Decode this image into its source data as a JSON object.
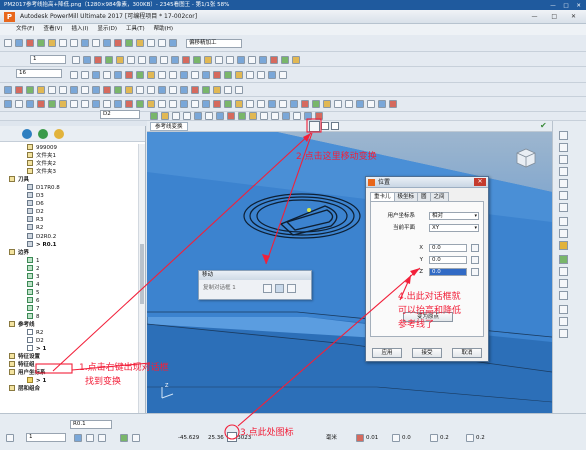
{
  "viewer": {
    "title": "PM2017参考线抬高+降低.png（1280×984像素，300KB）- 2345看图王 - 第1/1张 58%",
    "window_controls": "— □ ✕"
  },
  "app": {
    "logo": "P",
    "title": "Autodesk PowerMill Ultimate 2017   [可编程项目 * 17-002cor]"
  },
  "menu": [
    "文件(F)",
    "查看(V)",
    "插入(I)",
    "显示(D)",
    "工具(T)",
    "帮助(H)"
  ],
  "toolbar": {
    "combo_level": "1",
    "combo_num": "16",
    "toolpath_label": "偏移精加工",
    "combo_d2": "D2"
  },
  "left_panel": {
    "tree": [
      {
        "label": "999009",
        "kind": "folder",
        "indent": 3
      },
      {
        "label": "文件夹1",
        "kind": "folder",
        "indent": 3
      },
      {
        "label": "文件夹2",
        "kind": "folder",
        "indent": 3
      },
      {
        "label": "文件夹3",
        "kind": "folder",
        "indent": 3
      },
      {
        "label": "刀具",
        "kind": "group",
        "indent": 1
      },
      {
        "label": "D17R0.8",
        "kind": "tool",
        "indent": 3
      },
      {
        "label": "D3",
        "kind": "tool",
        "indent": 3
      },
      {
        "label": "D6",
        "kind": "tool",
        "indent": 3
      },
      {
        "label": "D2",
        "kind": "tool",
        "indent": 3
      },
      {
        "label": "R3",
        "kind": "tool",
        "indent": 3
      },
      {
        "label": "R2",
        "kind": "tool",
        "indent": 3
      },
      {
        "label": "D2R0.2",
        "kind": "tool",
        "indent": 3
      },
      {
        "label": "> R0.1",
        "kind": "tool",
        "indent": 3,
        "bold": true
      },
      {
        "label": "边界",
        "kind": "group",
        "indent": 1
      },
      {
        "label": "1",
        "kind": "bound",
        "indent": 3
      },
      {
        "label": "2",
        "kind": "bound",
        "indent": 3
      },
      {
        "label": "3",
        "kind": "bound",
        "indent": 3
      },
      {
        "label": "4",
        "kind": "bound",
        "indent": 3
      },
      {
        "label": "5",
        "kind": "bound",
        "indent": 3
      },
      {
        "label": "6",
        "kind": "bound",
        "indent": 3
      },
      {
        "label": "7",
        "kind": "bound",
        "indent": 3
      },
      {
        "label": "8",
        "kind": "bound",
        "indent": 3
      },
      {
        "label": "参考线",
        "kind": "group",
        "indent": 1
      },
      {
        "label": "R2",
        "kind": "wp",
        "indent": 3
      },
      {
        "label": "D2",
        "kind": "wp",
        "indent": 3
      },
      {
        "label": "> 1",
        "kind": "wp",
        "indent": 3,
        "bold": true
      },
      {
        "label": "特征设置",
        "kind": "group",
        "indent": 1
      },
      {
        "label": "特征组",
        "kind": "group",
        "indent": 1
      },
      {
        "label": "用户坐标系",
        "kind": "group",
        "indent": 1
      },
      {
        "label": "> 1",
        "kind": "flag",
        "indent": 3,
        "bold": true
      },
      {
        "label": "层和组合",
        "kind": "group",
        "indent": 1
      }
    ]
  },
  "viewport": {
    "tab_label": "参考线变换"
  },
  "move_dialog": {
    "title": "移动",
    "option": "复制对话框 1"
  },
  "dialog": {
    "title": "位置",
    "close": "✕",
    "tabs": [
      "重卡儿",
      "极坐标",
      "圆",
      "之间"
    ],
    "user_cs_label": "用户坐标系",
    "user_cs_value": "相对",
    "plane_label": "当前平面",
    "plane_value": "XY",
    "x_label": "X",
    "x_value": "0.0",
    "y_label": "Y",
    "y_value": "0.0",
    "z_label": "Z",
    "z_value": "0.0",
    "origin_button": "变为原点",
    "apply_button": "应用",
    "accept_button": "接受",
    "cancel_button": "取消"
  },
  "status_bar": {
    "combo_r01": "R0.1",
    "combo_1": "1",
    "x": "-45.629",
    "y": "25.36",
    "z": "-0.3023",
    "unit": "毫米",
    "v1": "0.01",
    "v2": "0.0",
    "v3": "0.2",
    "v4": "0.2"
  },
  "annotations": {
    "a1": "2.点击这里移动变换",
    "a2_line1": "1.点击右键出现对话框",
    "a2_line2": "找到变换",
    "a3": "3.点此处图标",
    "a4_line1": "4.出此对话框就",
    "a4_line2": "可以抬高和降低",
    "a4_line3": "参考线了",
    "color": "#f2203a"
  },
  "colors": {
    "viewport_top": "#9db6cf",
    "viewport_bottom": "#2f78c7",
    "part_surface": "#3a80cc"
  }
}
